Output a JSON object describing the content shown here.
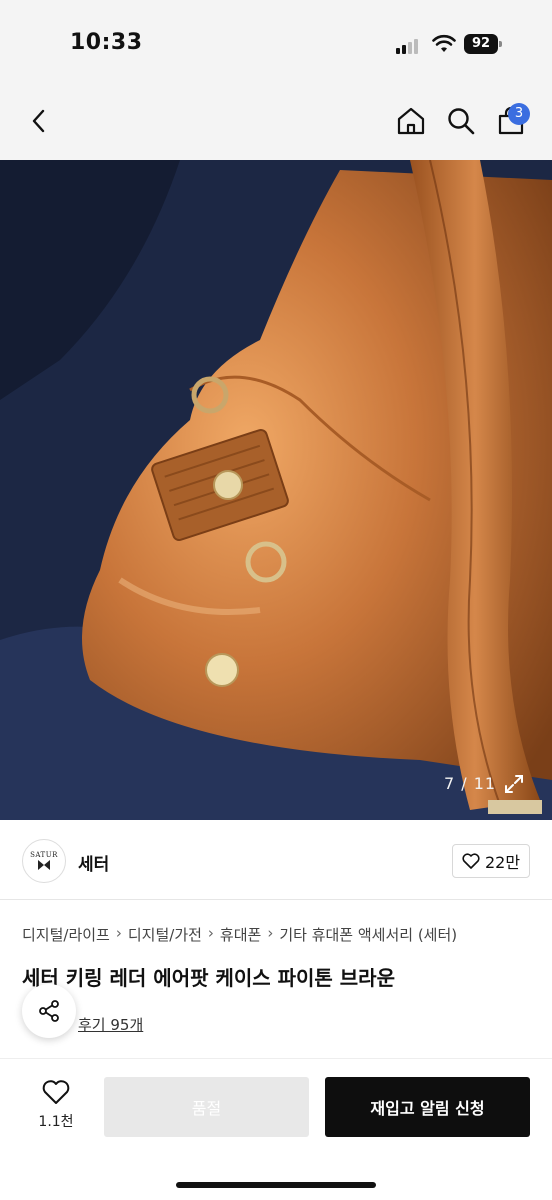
{
  "status_bar": {
    "time": "10:33",
    "battery": "92"
  },
  "nav": {
    "cart_badge": "3"
  },
  "gallery": {
    "counter": "7 / 11"
  },
  "brand": {
    "name": "세터",
    "logo_text": "SATUR",
    "likes": "22만"
  },
  "breadcrumb": [
    "디지털/라이프",
    "디지털/가전",
    "휴대폰",
    "기타 휴대폰 액세서리 (세터)"
  ],
  "product": {
    "title": "세터 키링 레더 에어팟 케이스 파이톤 브라운",
    "reviews": "후기 95개"
  },
  "bottom": {
    "wish_count": "1.1천",
    "soldout_label": "품절",
    "restock_label": "재입고 알림 신청"
  },
  "colors": {
    "badge": "#3b6ee0",
    "primary_button": "#0e0e0e",
    "disabled_button": "#e8e8e8"
  }
}
